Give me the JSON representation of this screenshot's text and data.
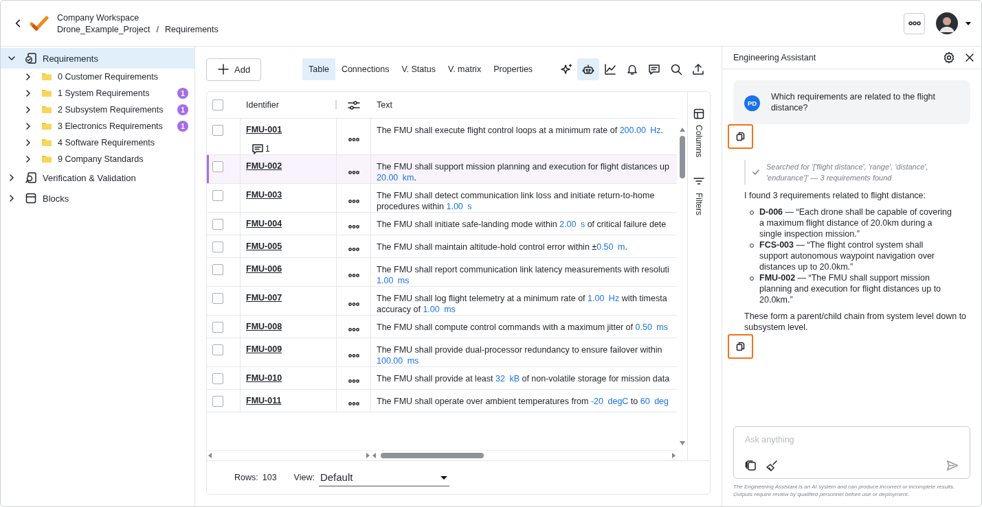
{
  "header": {
    "workspace": "Company Workspace",
    "breadcrumb": [
      "Drone_Example_Project",
      "Requirements"
    ],
    "separator": "/"
  },
  "sidebar": {
    "items": [
      {
        "label": "Requirements",
        "expanded": true,
        "selected": true,
        "children": [
          {
            "label": "0 Customer Requirements",
            "expanded": false,
            "selected": false
          },
          {
            "label": "1 System Requirements",
            "expanded": false,
            "selected": false,
            "badge": "1"
          },
          {
            "label": "2 Subsystem Requirements",
            "expanded": false,
            "selected": false,
            "badge": "1"
          },
          {
            "label": "3 Electronics Requirements",
            "expanded": false,
            "selected": false,
            "badge": "1"
          },
          {
            "label": "4 Software Requirements",
            "expanded": false,
            "selected": false
          },
          {
            "label": "9 Company Standards",
            "expanded": false,
            "selected": false
          }
        ]
      },
      {
        "label": "Verification & Validation",
        "expanded": false,
        "selected": false
      },
      {
        "label": "Blocks",
        "expanded": false,
        "selected": false
      }
    ]
  },
  "toolbar": {
    "add_button": "Add",
    "tabs": [
      {
        "label": "Table",
        "selected": true
      },
      {
        "label": "Connections",
        "selected": false
      },
      {
        "label": "V. Status",
        "selected": false
      },
      {
        "label": "V. matrix",
        "selected": false
      },
      {
        "label": "Properties",
        "selected": false
      }
    ],
    "tools": [
      {
        "kind": "sparkle",
        "active": false
      },
      {
        "kind": "robot",
        "active": true
      },
      {
        "kind": "chart",
        "active": false
      },
      {
        "kind": "bell",
        "active": false
      },
      {
        "kind": "comment",
        "active": false
      },
      {
        "kind": "search",
        "active": false
      },
      {
        "kind": "upload",
        "active": false
      }
    ]
  },
  "table": {
    "columns": [
      "Identifier",
      "Text"
    ],
    "select_all_checked": false,
    "rows": [
      {
        "id": "FMU-001",
        "checked": false,
        "selected": false,
        "comments": "1",
        "lines": [
          [
            {
              "kind": "plain",
              "t": "The FMU shall execute flight control loops at a minimum rate of "
            },
            {
              "kind": "quantity",
              "t": "200.00 Hz"
            },
            {
              "kind": "plain",
              "t": "."
            }
          ]
        ]
      },
      {
        "id": "FMU-002",
        "checked": false,
        "selected": true,
        "lines": [
          [
            {
              "kind": "plain",
              "t": "The FMU shall support mission planning and execution for flight distances up"
            }
          ],
          [
            {
              "kind": "quantity",
              "t": "20.00 km"
            },
            {
              "kind": "plain",
              "t": "."
            }
          ]
        ]
      },
      {
        "id": "FMU-003",
        "checked": false,
        "selected": false,
        "lines": [
          [
            {
              "kind": "plain",
              "t": "The FMU shall detect communication link loss and initiate return-to-home"
            }
          ],
          [
            {
              "kind": "plain",
              "t": "procedures within "
            },
            {
              "kind": "quantity",
              "t": "1.00 s"
            }
          ]
        ]
      },
      {
        "id": "FMU-004",
        "checked": false,
        "selected": false,
        "lines": [
          [
            {
              "kind": "plain",
              "t": "The FMU shall initiate safe-landing mode within "
            },
            {
              "kind": "quantity",
              "t": "2.00 s"
            },
            {
              "kind": "plain",
              "t": " of critical failure dete"
            }
          ]
        ]
      },
      {
        "id": "FMU-005",
        "checked": false,
        "selected": false,
        "lines": [
          [
            {
              "kind": "plain",
              "t": "The FMU shall maintain altitude-hold control error within ±"
            },
            {
              "kind": "quantity",
              "t": "0.50 m"
            },
            {
              "kind": "plain",
              "t": "."
            }
          ]
        ]
      },
      {
        "id": "FMU-006",
        "checked": false,
        "selected": false,
        "lines": [
          [
            {
              "kind": "plain",
              "t": "The FMU shall report communication link latency measurements with resoluti"
            }
          ],
          [
            {
              "kind": "quantity",
              "t": "1.00 ms"
            }
          ]
        ]
      },
      {
        "id": "FMU-007",
        "checked": false,
        "selected": false,
        "lines": [
          [
            {
              "kind": "plain",
              "t": "The FMU shall log flight telemetry at a minimum rate of "
            },
            {
              "kind": "quantity",
              "t": "1.00 Hz"
            },
            {
              "kind": "plain",
              "t": " with timesta"
            }
          ],
          [
            {
              "kind": "plain",
              "t": "accuracy of "
            },
            {
              "kind": "quantity",
              "t": "1.00 ms"
            }
          ]
        ]
      },
      {
        "id": "FMU-008",
        "checked": false,
        "selected": false,
        "lines": [
          [
            {
              "kind": "plain",
              "t": "The FMU shall compute control commands with a maximum jitter of "
            },
            {
              "kind": "quantity",
              "t": "0.50 ms"
            }
          ]
        ]
      },
      {
        "id": "FMU-009",
        "checked": false,
        "selected": false,
        "lines": [
          [
            {
              "kind": "plain",
              "t": "The FMU shall provide dual-processor redundancy to ensure failover within"
            }
          ],
          [
            {
              "kind": "quantity",
              "t": "100.00 ms"
            }
          ]
        ]
      },
      {
        "id": "FMU-010",
        "checked": false,
        "selected": false,
        "lines": [
          [
            {
              "kind": "plain",
              "t": "The FMU shall provide at least "
            },
            {
              "kind": "quantity",
              "t": "32 kB"
            },
            {
              "kind": "plain",
              "t": " of non-volatile storage for mission data"
            }
          ]
        ]
      },
      {
        "id": "FMU-011",
        "checked": false,
        "selected": false,
        "lines": [
          [
            {
              "kind": "plain",
              "t": "The FMU shall operate over ambient temperatures from "
            },
            {
              "kind": "quantity",
              "t": "-20 degC"
            },
            {
              "kind": "plain",
              "t": " to "
            },
            {
              "kind": "quantity",
              "t": "60 deg"
            }
          ]
        ]
      }
    ]
  },
  "side_tabs": [
    "Columns",
    "Filters"
  ],
  "footer": {
    "rows_label": "Rows:",
    "rows_count": "103",
    "view_label": "View:",
    "view": "Default"
  },
  "assistant": {
    "title": "Engineering Assistant",
    "user_message": {
      "initials": "PD",
      "text": "Which requirements are related to the flight distance?"
    },
    "copy_buttons": [
      {
        "highlighted": true
      },
      {
        "highlighted": true
      }
    ],
    "tool_call": "Searched for '['flight distance', 'range', 'distance', 'endurance']' — 3 requirements found",
    "intro": "I found 3 requirements related to flight distance:",
    "results": [
      "**D-006** — “Each drone shall be capable of covering a maximum flight distance of 20.0km during a single inspection mission.”",
      "**FCS-003** — “The flight control system shall support autonomous waypoint navigation over distances up to 20.0km.”",
      "**FMU-002** — “The FMU shall support mission planning and execution for flight distances up to 20.0km.”"
    ],
    "closing": "These form a parent/child chain from system level down to subsystem level.",
    "input": {
      "placeholder": "Ask anything"
    },
    "disclaimer": "The Engineering Assistant is an AI system and can produce incorrect or incomplete results. Outputs require review by qualified personnel before use or deployment."
  }
}
